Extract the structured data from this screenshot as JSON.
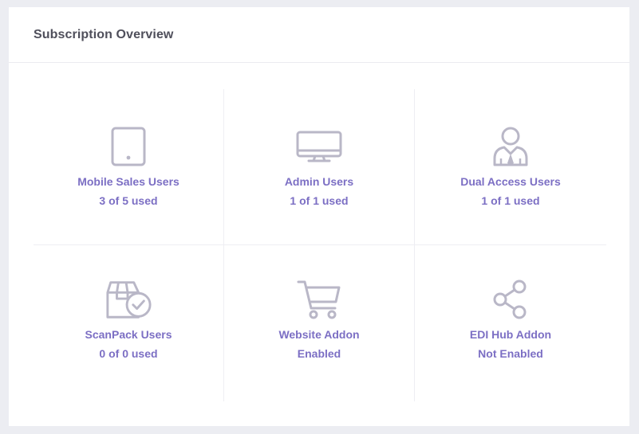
{
  "card": {
    "title": "Subscription Overview"
  },
  "colors": {
    "accent": "#7c6fc4",
    "icon": "#b9b7c7",
    "title": "#4f4f5b",
    "background": "#ecedf2"
  },
  "tiles": [
    {
      "icon": "tablet-icon",
      "label": "Mobile Sales Users",
      "value": "3 of 5 used"
    },
    {
      "icon": "monitor-icon",
      "label": "Admin Users",
      "value": "1 of 1 used"
    },
    {
      "icon": "user-suit-icon",
      "label": "Dual Access Users",
      "value": "1 of 1 used"
    },
    {
      "icon": "box-check-icon",
      "label": "ScanPack Users",
      "value": "0 of 0 used"
    },
    {
      "icon": "shopping-cart-icon",
      "label": "Website Addon",
      "value": "Enabled"
    },
    {
      "icon": "share-icon",
      "label": "EDI Hub Addon",
      "value": "Not Enabled"
    }
  ]
}
